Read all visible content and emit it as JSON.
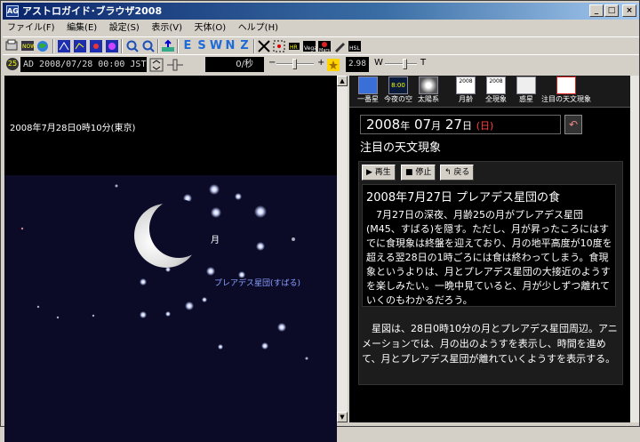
{
  "window": {
    "title": "アストロガイド･ブラウザ2008",
    "app_icon": "AG",
    "min_label": "_",
    "max_label": "□",
    "close_label": "×"
  },
  "menu": [
    "ファイル(F)",
    "編集(E)",
    "設定(S)",
    "表示(V)",
    "天体(O)",
    "ヘルプ(H)"
  ],
  "toolbar": {
    "dir_e": "E",
    "dir_s": "S",
    "dir_w": "W",
    "dir_n": "N",
    "dir_z": "Z"
  },
  "time": {
    "age": "25",
    "datetime": "AD  2008/07/28 00:00 JST",
    "rate": "0/秒",
    "minus": "−",
    "plus": "+",
    "mag": "2.98",
    "w_label": "W",
    "t_label": "T"
  },
  "sky": {
    "caption": "2008年7月28日0時10分(東京)",
    "moon_label": "月",
    "cluster_label": "プレアデス星団(すばる)"
  },
  "nav": {
    "items": [
      "一番星",
      "今夜の空",
      "太陽系",
      "月齢",
      "全現象",
      "惑星",
      "注目の天文現象"
    ],
    "icon_2008a": "2008",
    "icon_2008b": "2008",
    "icon_800": "8:00"
  },
  "panel": {
    "date_year": "2008",
    "date_year_unit": "年",
    "date_month": "07",
    "date_month_unit": "月",
    "date_day": "27",
    "date_day_unit": "日",
    "weekday": "(日)",
    "section_title": "注目の天文現象",
    "play": "▶ 再生",
    "stop": "■ 停止",
    "back": "↰ 戻る",
    "event_title": "2008年7月27日 プレアデス星団の食",
    "event_body": "7月27日の深夜、月齢25の月がプレアデス星団(M45、すばる)を隠す。ただし、月が昇ったころにはすでに食現象は終盤を迎えており、月の地平高度が10度を超える翌28日の1時ごろには食は終わってしまう。食現象というよりは、月とプレアデス星団の大接近のようすを楽しみたい。一晩中見ていると、月が少しずつ離れていくのもわかるだろう。",
    "note": "星図は、28日0時10分の月とプレアデス星団周辺。アニメーションでは、月の出のようすを表示し、時間を進めて、月とプレアデス星団が離れていくようすを表示する。"
  }
}
